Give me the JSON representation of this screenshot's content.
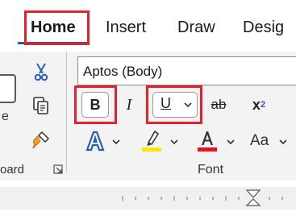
{
  "tabs": {
    "home": "Home",
    "insert": "Insert",
    "draw": "Draw",
    "design": "Desig"
  },
  "clipboard": {
    "partial_label": "e",
    "group_label": "oard"
  },
  "font": {
    "name_value": "Aptos (Body)",
    "bold_label": "B",
    "italic_label": "I",
    "underline_label": "U",
    "strike_label": "ab",
    "subscript_base": "x",
    "subscript_sub": "2",
    "change_case_label": "Aa",
    "group_label": "Font"
  },
  "colors": {
    "annotation_red": "#e4222f",
    "font_color_red": "#e81123",
    "highlight_yellow": "#ffe600",
    "text_effect_blue": "#2b5cb8",
    "tab_accent": "#2b579a"
  },
  "icons": [
    "cut-icon",
    "copy-icon",
    "format-painter-icon",
    "text-effects-icon",
    "highlight-icon",
    "font-color-icon",
    "dialog-launcher-icon",
    "chevron-down-icon"
  ]
}
